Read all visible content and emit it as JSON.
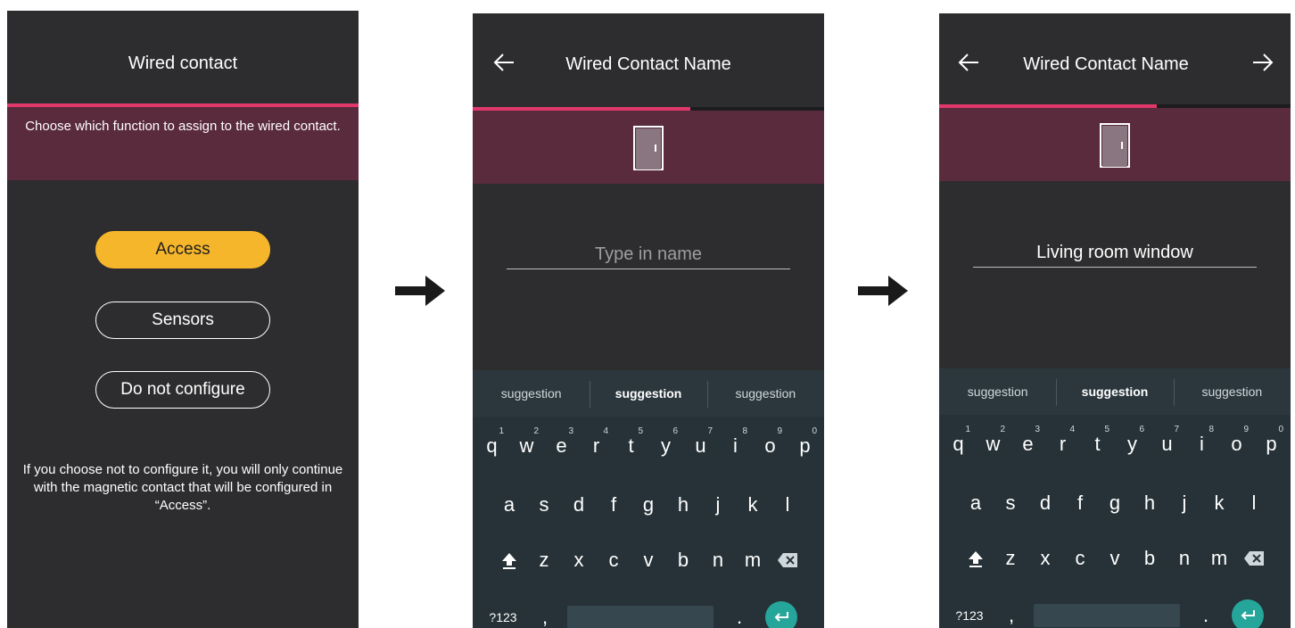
{
  "screen1": {
    "title": "Wired contact",
    "progress": 1.0,
    "banner": "Choose which function to assign to the wired contact.",
    "options": [
      {
        "label": "Access",
        "selected": true
      },
      {
        "label": "Sensors",
        "selected": false
      },
      {
        "label": "Do not configure",
        "selected": false
      }
    ],
    "note": "If you choose not to configure it, you will only continue with the magnetic contact that will be configured in “Access”."
  },
  "screen2": {
    "title": "Wired Contact Name",
    "progress": 0.62,
    "input_placeholder": "Type in name",
    "input_value": "",
    "icon": "door-icon",
    "suggestions": [
      "suggestion",
      "suggestion",
      "suggestion"
    ]
  },
  "screen3": {
    "title": "Wired Contact Name",
    "progress": 0.62,
    "input_placeholder": "Type in name",
    "input_value": "Living room window",
    "icon": "door-icon",
    "suggestions": [
      "suggestion",
      "suggestion",
      "suggestion"
    ]
  },
  "keyboard": {
    "row1": [
      "q",
      "w",
      "e",
      "r",
      "t",
      "y",
      "u",
      "i",
      "o",
      "p"
    ],
    "row1_hints": [
      "1",
      "2",
      "3",
      "4",
      "5",
      "6",
      "7",
      "8",
      "9",
      "0"
    ],
    "row2": [
      "a",
      "s",
      "d",
      "f",
      "g",
      "h",
      "j",
      "k",
      "l"
    ],
    "row3": [
      "z",
      "x",
      "c",
      "v",
      "b",
      "n",
      "m"
    ],
    "symbols_label": "?123",
    "comma": ",",
    "period": "."
  },
  "colors": {
    "screen_bg": "#2d2d2f",
    "accent_pink": "#e0386a",
    "banner": "#5a2a3d",
    "primary_button": "#f6b62b",
    "keyboard_bg": "#263238",
    "enter_key": "#26a69a"
  }
}
